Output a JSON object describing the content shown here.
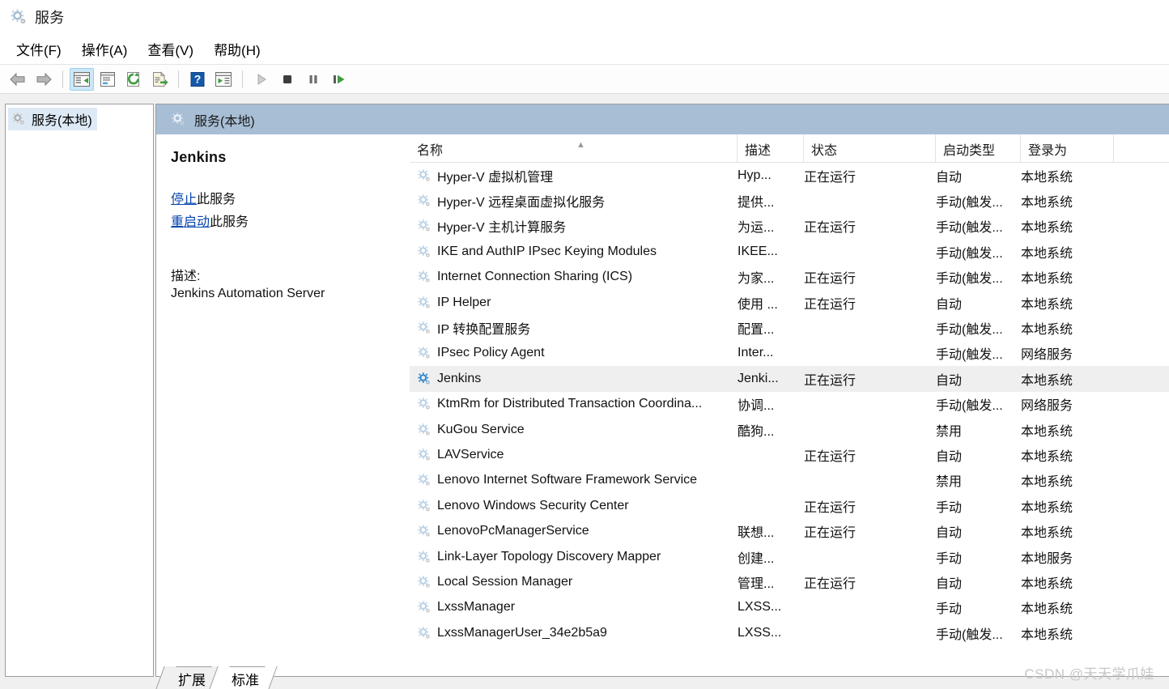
{
  "window": {
    "title": "服务",
    "icon": "gear-icon"
  },
  "menubar": {
    "items": [
      {
        "label": "文件(F)",
        "name": "menu-file"
      },
      {
        "label": "操作(A)",
        "name": "menu-action"
      },
      {
        "label": "查看(V)",
        "name": "menu-view"
      },
      {
        "label": "帮助(H)",
        "name": "menu-help"
      }
    ]
  },
  "toolbar": {
    "buttons": [
      {
        "icon": "back-arrow-icon",
        "name": "toolbar-back",
        "active": false
      },
      {
        "icon": "forward-arrow-icon",
        "name": "toolbar-forward",
        "active": false
      },
      {
        "icon": "show-hide-console-tree-icon",
        "name": "toolbar-show-tree",
        "active": true
      },
      {
        "icon": "properties-icon",
        "name": "toolbar-properties",
        "active": false
      },
      {
        "icon": "refresh-icon",
        "name": "toolbar-refresh",
        "active": false
      },
      {
        "icon": "export-list-icon",
        "name": "toolbar-export-list",
        "active": false
      },
      {
        "icon": "help-icon",
        "name": "toolbar-help",
        "active": false
      },
      {
        "icon": "show-action-pane-icon",
        "name": "toolbar-action-pane",
        "active": false
      },
      {
        "icon": "play-icon",
        "name": "toolbar-start-service",
        "active": false
      },
      {
        "icon": "stop-icon",
        "name": "toolbar-stop-service",
        "active": false
      },
      {
        "icon": "pause-icon",
        "name": "toolbar-pause-service",
        "active": false
      },
      {
        "icon": "restart-icon",
        "name": "toolbar-restart-service",
        "active": false
      }
    ]
  },
  "tree": {
    "root_label": "服务(本地)"
  },
  "pane": {
    "header_label": "服务(本地)"
  },
  "detail": {
    "service_name": "Jenkins",
    "links": [
      {
        "link_text": "停止",
        "suffix": "此服务"
      },
      {
        "link_text": "重启动",
        "suffix": "此服务"
      }
    ],
    "description_label": "描述:",
    "description_text": "Jenkins Automation Server"
  },
  "list": {
    "sort_indicator": "▲",
    "columns": [
      {
        "label": "名称",
        "key": "name"
      },
      {
        "label": "描述",
        "key": "description"
      },
      {
        "label": "状态",
        "key": "status"
      },
      {
        "label": "启动类型",
        "key": "startup"
      },
      {
        "label": "登录为",
        "key": "logon"
      }
    ],
    "rows": [
      {
        "name": "Hyper-V 虚拟机管理",
        "description": "Hyp...",
        "status": "正在运行",
        "startup": "自动",
        "logon": "本地系统",
        "selected": false
      },
      {
        "name": "Hyper-V 远程桌面虚拟化服务",
        "description": "提供...",
        "status": "",
        "startup": "手动(触发...",
        "logon": "本地系统",
        "selected": false
      },
      {
        "name": "Hyper-V 主机计算服务",
        "description": "为运...",
        "status": "正在运行",
        "startup": "手动(触发...",
        "logon": "本地系统",
        "selected": false
      },
      {
        "name": "IKE and AuthIP IPsec Keying Modules",
        "description": "IKEE...",
        "status": "",
        "startup": "手动(触发...",
        "logon": "本地系统",
        "selected": false
      },
      {
        "name": "Internet Connection Sharing (ICS)",
        "description": "为家...",
        "status": "正在运行",
        "startup": "手动(触发...",
        "logon": "本地系统",
        "selected": false
      },
      {
        "name": "IP Helper",
        "description": "使用 ...",
        "status": "正在运行",
        "startup": "自动",
        "logon": "本地系统",
        "selected": false
      },
      {
        "name": "IP 转换配置服务",
        "description": "配置...",
        "status": "",
        "startup": "手动(触发...",
        "logon": "本地系统",
        "selected": false
      },
      {
        "name": "IPsec Policy Agent",
        "description": "Inter...",
        "status": "",
        "startup": "手动(触发...",
        "logon": "网络服务",
        "selected": false
      },
      {
        "name": "Jenkins",
        "description": "Jenki...",
        "status": "正在运行",
        "startup": "自动",
        "logon": "本地系统",
        "selected": true
      },
      {
        "name": "KtmRm for Distributed Transaction Coordina...",
        "description": "协调...",
        "status": "",
        "startup": "手动(触发...",
        "logon": "网络服务",
        "selected": false
      },
      {
        "name": "KuGou Service",
        "description": "酷狗...",
        "status": "",
        "startup": "禁用",
        "logon": "本地系统",
        "selected": false
      },
      {
        "name": "LAVService",
        "description": "",
        "status": "正在运行",
        "startup": "自动",
        "logon": "本地系统",
        "selected": false
      },
      {
        "name": "Lenovo Internet Software Framework Service",
        "description": "",
        "status": "",
        "startup": "禁用",
        "logon": "本地系统",
        "selected": false
      },
      {
        "name": "Lenovo Windows Security Center",
        "description": "",
        "status": "正在运行",
        "startup": "手动",
        "logon": "本地系统",
        "selected": false
      },
      {
        "name": "LenovoPcManagerService",
        "description": "联想...",
        "status": "正在运行",
        "startup": "自动",
        "logon": "本地系统",
        "selected": false
      },
      {
        "name": "Link-Layer Topology Discovery Mapper",
        "description": "创建...",
        "status": "",
        "startup": "手动",
        "logon": "本地服务",
        "selected": false
      },
      {
        "name": "Local Session Manager",
        "description": "管理...",
        "status": "正在运行",
        "startup": "自动",
        "logon": "本地系统",
        "selected": false
      },
      {
        "name": "LxssManager",
        "description": "LXSS...",
        "status": "",
        "startup": "手动",
        "logon": "本地系统",
        "selected": false
      },
      {
        "name": "LxssManagerUser_34e2b5a9",
        "description": "LXSS...",
        "status": "",
        "startup": "手动(触发...",
        "logon": "本地系统",
        "selected": false
      }
    ]
  },
  "tabs": [
    {
      "label": "扩展",
      "name": "tab-extended",
      "selected": false
    },
    {
      "label": "标准",
      "name": "tab-standard",
      "selected": true
    }
  ],
  "watermark": {
    "text": "CSDN @天天学爪娃"
  },
  "colors": {
    "pane_header": "#a8bed5",
    "selected_row": "#efefef",
    "link": "#0645ad",
    "toolbar_active": "#cce8f6",
    "tree_selection": "#ddeaf6"
  }
}
